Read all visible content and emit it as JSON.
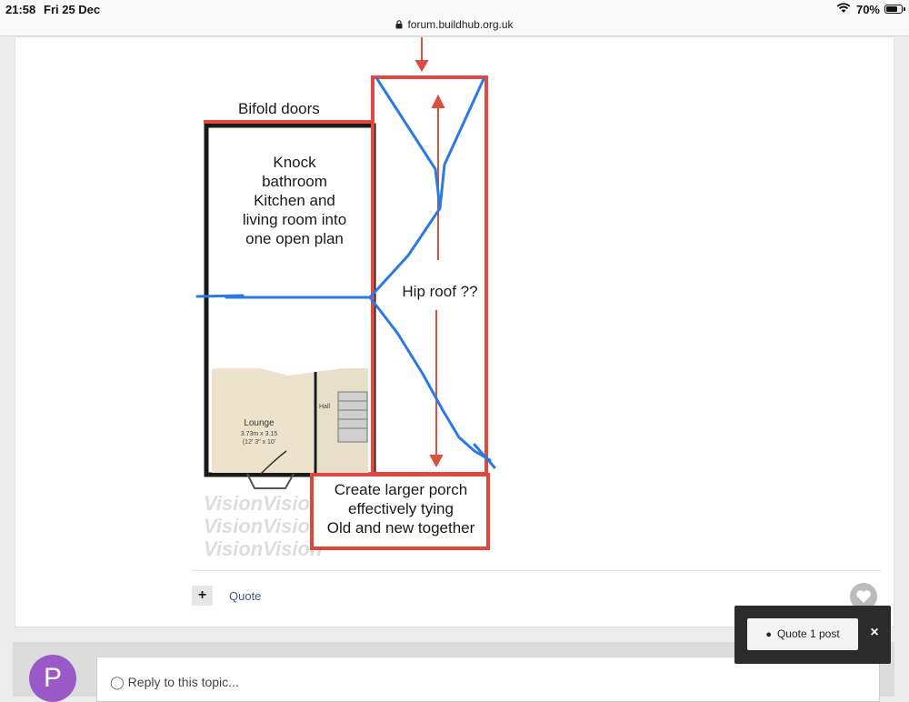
{
  "status_bar": {
    "time": "21:58",
    "date": "Fri 25 Dec",
    "battery": "70%"
  },
  "browser": {
    "url": "forum.buildhub.org.uk"
  },
  "diagram": {
    "bifold_label": "Bifold doors",
    "knock_text": [
      "Knock",
      "bathroom",
      "Kitchen and",
      "living room into",
      "one open plan"
    ],
    "hip_roof": "Hip roof ??",
    "porch_text": [
      "Create larger porch",
      "effectively tying",
      "Old and new together"
    ],
    "lounge_label": "Lounge",
    "lounge_dims": [
      "3.73m x 3.15",
      "(12' 3\" x 10'"
    ],
    "hall_label": "Hall",
    "watermark": "VisionVision"
  },
  "post_actions": {
    "plus": "+",
    "quote": "Quote"
  },
  "reply": {
    "avatar_letter": "P",
    "placeholder": "Reply to this topic..."
  },
  "quote_popup": {
    "button": "Quote 1 post",
    "close": "×"
  }
}
